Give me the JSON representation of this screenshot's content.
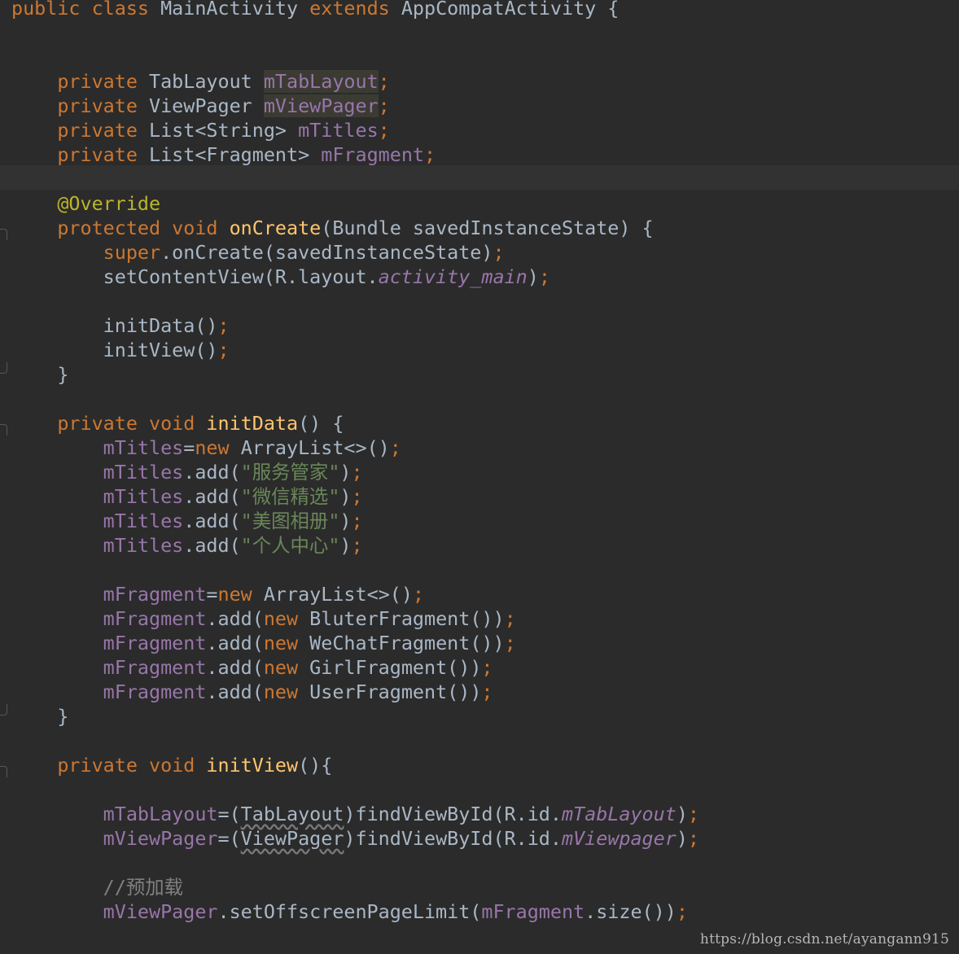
{
  "editor": {
    "theme_colors": {
      "background": "#2b2b2b",
      "current_line": "#323232",
      "keyword": "#cc7832",
      "field": "#9876aa",
      "method_declaration": "#ffc66d",
      "annotation": "#bbb529",
      "string": "#6a8759",
      "comment": "#808080",
      "default_text": "#a9b7c6"
    },
    "lines": [
      [
        {
          "t": "public class ",
          "k": "kw"
        },
        {
          "t": "MainActivity ",
          "k": "dim"
        },
        {
          "t": "extends ",
          "k": "kw"
        },
        {
          "t": "AppCompatActivity {",
          "k": "dim"
        }
      ],
      [],
      [],
      [
        {
          "t": "    private ",
          "k": "kw"
        },
        {
          "t": "TabLayout ",
          "k": "dim"
        },
        {
          "t": "mTabLayout",
          "k": "fld hl"
        },
        {
          "t": ";",
          "k": "kw"
        }
      ],
      [
        {
          "t": "    private ",
          "k": "kw"
        },
        {
          "t": "ViewPager ",
          "k": "dim"
        },
        {
          "t": "mViewPager",
          "k": "fld hl"
        },
        {
          "t": ";",
          "k": "kw"
        }
      ],
      [
        {
          "t": "    private ",
          "k": "kw"
        },
        {
          "t": "List<String> ",
          "k": "dim"
        },
        {
          "t": "mTitles",
          "k": "fld"
        },
        {
          "t": ";",
          "k": "kw"
        }
      ],
      [
        {
          "t": "    private ",
          "k": "kw"
        },
        {
          "t": "List<Fragment> ",
          "k": "dim"
        },
        {
          "t": "mFragment",
          "k": "fld"
        },
        {
          "t": ";",
          "k": "kw"
        }
      ],
      [],
      [
        {
          "t": "    @Override",
          "k": "ann"
        }
      ],
      [
        {
          "t": "    protected void ",
          "k": "kw"
        },
        {
          "t": "onCreate",
          "k": "mth"
        },
        {
          "t": "(Bundle savedInstanceState) {",
          "k": "dim"
        }
      ],
      [
        {
          "t": "        super",
          "k": "kw"
        },
        {
          "t": ".onCreate(savedInstanceState)",
          "k": "dim"
        },
        {
          "t": ";",
          "k": "kw"
        }
      ],
      [
        {
          "t": "        setContentView(R.layout.",
          "k": "dim"
        },
        {
          "t": "activity_main",
          "k": "fld-i"
        },
        {
          "t": ")",
          "k": "dim"
        },
        {
          "t": ";",
          "k": "kw"
        }
      ],
      [],
      [
        {
          "t": "        initData()",
          "k": "dim"
        },
        {
          "t": ";",
          "k": "kw"
        }
      ],
      [
        {
          "t": "        initView()",
          "k": "dim"
        },
        {
          "t": ";",
          "k": "kw"
        }
      ],
      [
        {
          "t": "    }",
          "k": "dim"
        }
      ],
      [],
      [
        {
          "t": "    private void ",
          "k": "kw"
        },
        {
          "t": "initData",
          "k": "mth"
        },
        {
          "t": "() {",
          "k": "dim"
        }
      ],
      [
        {
          "t": "        mTitles",
          "k": "fld"
        },
        {
          "t": "=",
          "k": "dim"
        },
        {
          "t": "new ",
          "k": "kw"
        },
        {
          "t": "ArrayList<>()",
          "k": "dim"
        },
        {
          "t": ";",
          "k": "kw"
        }
      ],
      [
        {
          "t": "        mTitles",
          "k": "fld"
        },
        {
          "t": ".add(",
          "k": "dim"
        },
        {
          "t": "\"服务管家\"",
          "k": "str"
        },
        {
          "t": ")",
          "k": "dim"
        },
        {
          "t": ";",
          "k": "kw"
        }
      ],
      [
        {
          "t": "        mTitles",
          "k": "fld"
        },
        {
          "t": ".add(",
          "k": "dim"
        },
        {
          "t": "\"微信精选\"",
          "k": "str"
        },
        {
          "t": ")",
          "k": "dim"
        },
        {
          "t": ";",
          "k": "kw"
        }
      ],
      [
        {
          "t": "        mTitles",
          "k": "fld"
        },
        {
          "t": ".add(",
          "k": "dim"
        },
        {
          "t": "\"美图相册\"",
          "k": "str"
        },
        {
          "t": ")",
          "k": "dim"
        },
        {
          "t": ";",
          "k": "kw"
        }
      ],
      [
        {
          "t": "        mTitles",
          "k": "fld"
        },
        {
          "t": ".add(",
          "k": "dim"
        },
        {
          "t": "\"个人中心\"",
          "k": "str"
        },
        {
          "t": ")",
          "k": "dim"
        },
        {
          "t": ";",
          "k": "kw"
        }
      ],
      [],
      [
        {
          "t": "        mFragment",
          "k": "fld"
        },
        {
          "t": "=",
          "k": "dim"
        },
        {
          "t": "new ",
          "k": "kw"
        },
        {
          "t": "ArrayList<>()",
          "k": "dim"
        },
        {
          "t": ";",
          "k": "kw"
        }
      ],
      [
        {
          "t": "        mFragment",
          "k": "fld"
        },
        {
          "t": ".add(",
          "k": "dim"
        },
        {
          "t": "new ",
          "k": "kw"
        },
        {
          "t": "BluterFragment())",
          "k": "dim"
        },
        {
          "t": ";",
          "k": "kw"
        }
      ],
      [
        {
          "t": "        mFragment",
          "k": "fld"
        },
        {
          "t": ".add(",
          "k": "dim"
        },
        {
          "t": "new ",
          "k": "kw"
        },
        {
          "t": "WeChatFragment())",
          "k": "dim"
        },
        {
          "t": ";",
          "k": "kw"
        }
      ],
      [
        {
          "t": "        mFragment",
          "k": "fld"
        },
        {
          "t": ".add(",
          "k": "dim"
        },
        {
          "t": "new ",
          "k": "kw"
        },
        {
          "t": "GirlFragment())",
          "k": "dim"
        },
        {
          "t": ";",
          "k": "kw"
        }
      ],
      [
        {
          "t": "        mFragment",
          "k": "fld"
        },
        {
          "t": ".add(",
          "k": "dim"
        },
        {
          "t": "new ",
          "k": "kw"
        },
        {
          "t": "UserFragment())",
          "k": "dim"
        },
        {
          "t": ";",
          "k": "kw"
        }
      ],
      [
        {
          "t": "    }",
          "k": "dim"
        }
      ],
      [],
      [
        {
          "t": "    private void ",
          "k": "kw"
        },
        {
          "t": "initView",
          "k": "mth"
        },
        {
          "t": "(){",
          "k": "dim"
        }
      ],
      [],
      [
        {
          "t": "        mTabLayout",
          "k": "fld"
        },
        {
          "t": "=(",
          "k": "dim"
        },
        {
          "t": "TabLayout",
          "k": "warn"
        },
        {
          "t": ")findViewById(R.id.",
          "k": "dim"
        },
        {
          "t": "mTabLayout",
          "k": "fld-i"
        },
        {
          "t": ")",
          "k": "dim"
        },
        {
          "t": ";",
          "k": "kw"
        }
      ],
      [
        {
          "t": "        mViewPager",
          "k": "fld"
        },
        {
          "t": "=(",
          "k": "dim"
        },
        {
          "t": "ViewPager",
          "k": "warn"
        },
        {
          "t": ")findViewById(R.id.",
          "k": "dim"
        },
        {
          "t": "mViewpager",
          "k": "fld-i"
        },
        {
          "t": ")",
          "k": "dim"
        },
        {
          "t": ";",
          "k": "kw"
        }
      ],
      [],
      [
        {
          "t": "        //预加载",
          "k": "com"
        }
      ],
      [
        {
          "t": "        mViewPager",
          "k": "fld"
        },
        {
          "t": ".setOffscreenPageLimit(",
          "k": "dim"
        },
        {
          "t": "mFragment",
          "k": "fld"
        },
        {
          "t": ".size())",
          "k": "dim"
        },
        {
          "t": ";",
          "k": "kw"
        }
      ]
    ],
    "fold_markers": [
      {
        "line": 9,
        "kind": "open"
      },
      {
        "line": 15,
        "kind": "close"
      },
      {
        "line": 17,
        "kind": "open"
      },
      {
        "line": 29,
        "kind": "close"
      },
      {
        "line": 31,
        "kind": "open"
      }
    ],
    "current_line_index": 7
  },
  "watermark": "https://blog.csdn.net/ayangann915"
}
